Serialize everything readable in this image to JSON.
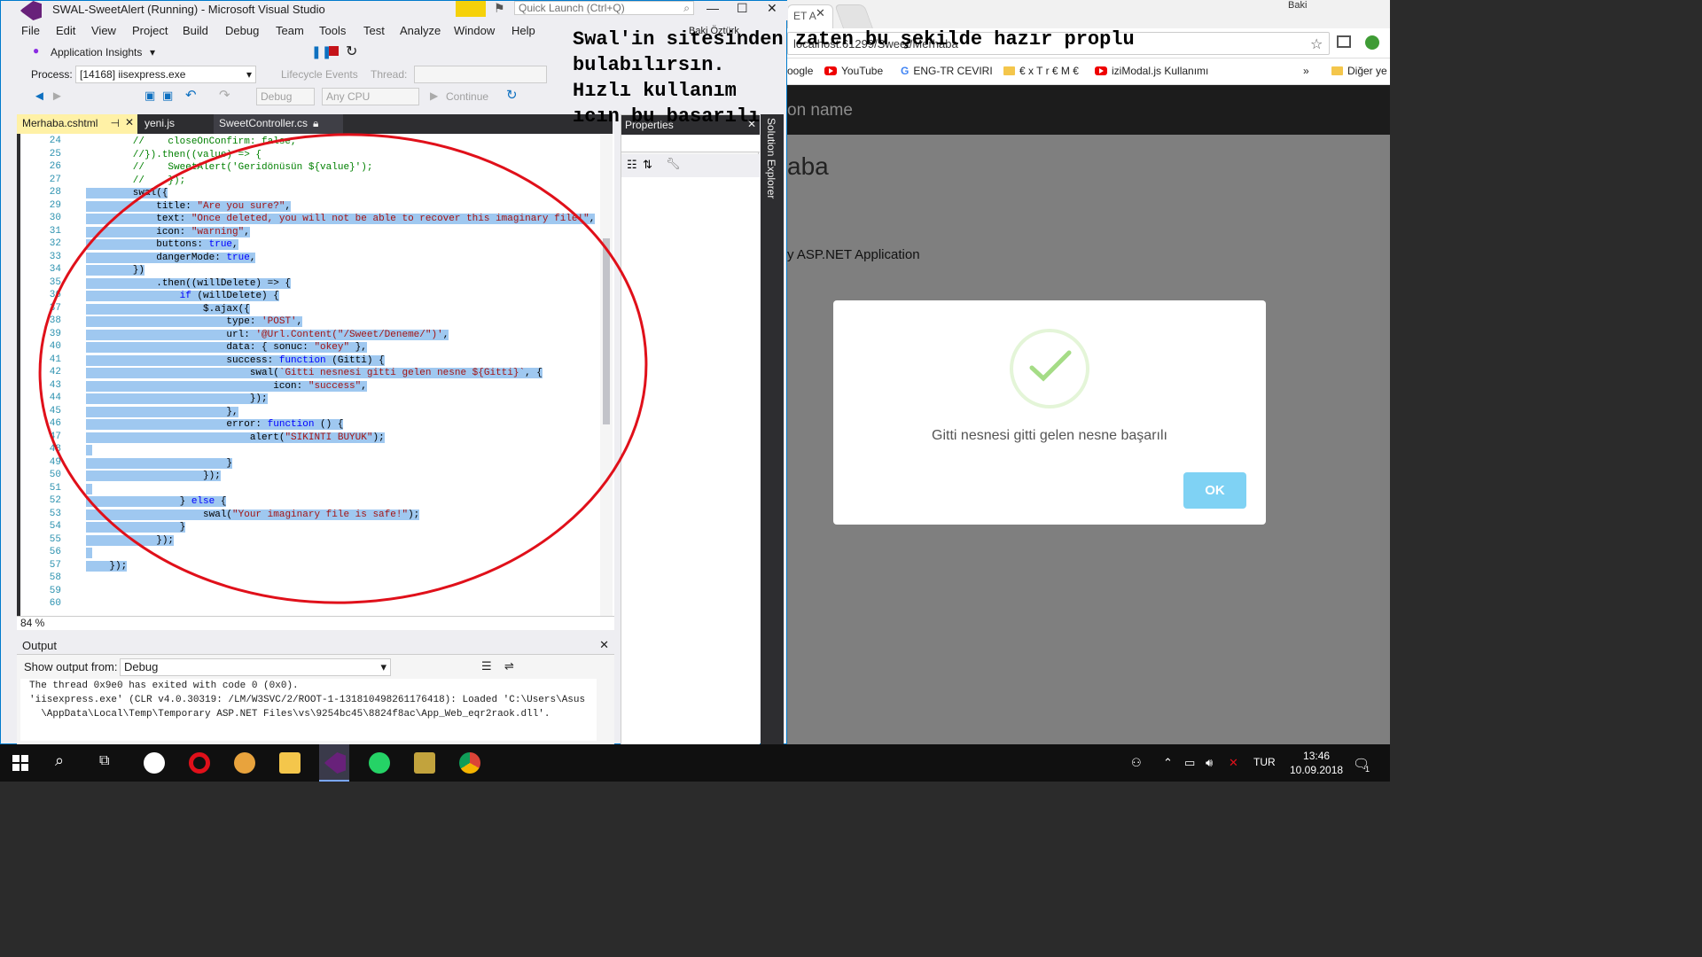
{
  "browser": {
    "tabs": [
      "ET A",
      ""
    ],
    "address_fragment": "localhost:61299/Sweet/Merhaba",
    "bookmarks": [
      "oogle",
      "YouTube",
      "ENG-TR CEVIRI",
      "€ x T r € M €",
      "iziModal.js Kullanımı"
    ],
    "bookmarks_more": "»",
    "other_bookmarks": "Diğer ye",
    "user_name": "Baki",
    "site_brand": "on name",
    "site_h1": "aba",
    "site_p": "y ASP.NET Application",
    "modal": {
      "text": "Gitti nesnesi gitti gelen nesne başarılı",
      "ok_label": "OK",
      "ok_color": "#7fd2f4",
      "check_color": "#a5dc86"
    }
  },
  "vs": {
    "title": "SWAL-SweetAlert (Running) - Microsoft Visual Studio",
    "quick_launch_placeholder": "Quick Launch (Ctrl+Q)",
    "user": "Baki Öztürk",
    "menu": [
      "File",
      "Edit",
      "View",
      "Project",
      "Build",
      "Debug",
      "Team",
      "Tools",
      "Test",
      "Analyze",
      "Window",
      "Help"
    ],
    "toolbar1": {
      "app_insights": "Application Insights"
    },
    "toolbar2": {
      "process_label": "Process:",
      "process_value": "[14168] iisexpress.exe",
      "lifecycle": "Lifecycle Events",
      "thread_label": "Thread:"
    },
    "toolbar3": {
      "config": "Debug",
      "platform": "Any CPU",
      "continue": "Continue"
    },
    "doc_tabs": [
      "Merhaba.cshtml",
      "yeni.js",
      "SweetController.cs"
    ],
    "zoom": "84 %",
    "properties_title": "Properties",
    "solution_explorer": "Solution Explorer",
    "output": {
      "title": "Output",
      "show_from_label": "Show output from:",
      "show_from_value": "Debug",
      "lines": [
        "The thread 0x9e0 has exited with code 0 (0x0).",
        "'iisexpress.exe' (CLR v4.0.30319: /LM/W3SVC/2/ROOT-1-131810498261176418): Loaded 'C:\\Users\\Asus",
        "  \\AppData\\Local\\Temp\\Temporary ASP.NET Files\\vs\\9254bc45\\8824f8ac\\App_Web_eqr2raok.dll'."
      ]
    },
    "code_lines": [
      {
        "n": "24",
        "t": "        //    closeOnConfirm: false,"
      },
      {
        "n": "25",
        "t": "        //}).then((value) => {"
      },
      {
        "n": "26",
        "t": "        //    SweetAlert('Geridönüsün ${value}');"
      },
      {
        "n": "27",
        "t": "        //    });"
      },
      {
        "n": "28",
        "t": "        swal({"
      },
      {
        "n": "29",
        "t": "            title: \"Are you sure?\","
      },
      {
        "n": "30",
        "t": "            text: \"Once deleted, you will not be able to recover this imaginary file!\","
      },
      {
        "n": "31",
        "t": "            icon: \"warning\","
      },
      {
        "n": "32",
        "t": "            buttons: true,"
      },
      {
        "n": "33",
        "t": "            dangerMode: true,"
      },
      {
        "n": "34",
        "t": "        })"
      },
      {
        "n": "35",
        "t": "            .then((willDelete) => {"
      },
      {
        "n": "36",
        "t": "                if (willDelete) {"
      },
      {
        "n": "37",
        "t": "                    $.ajax({"
      },
      {
        "n": "38",
        "t": "                        type: 'POST',"
      },
      {
        "n": "39",
        "t": "                        url: '@Url.Content(\"/Sweet/Deneme/\")',"
      },
      {
        "n": "40",
        "t": "                        data: { sonuc: \"okey\" },"
      },
      {
        "n": "41",
        "t": "                        success: function (Gitti) {"
      },
      {
        "n": "42",
        "t": "                            swal(`Gitti nesnesi gitti gelen nesne ${Gitti}`, {"
      },
      {
        "n": "43",
        "t": "                                icon: \"success\","
      },
      {
        "n": "44",
        "t": "                            });"
      },
      {
        "n": "45",
        "t": "                        },"
      },
      {
        "n": "46",
        "t": "                        error: function () {"
      },
      {
        "n": "47",
        "t": "                            alert(\"SIKINTI BUYUK\");"
      },
      {
        "n": "48",
        "t": " "
      },
      {
        "n": "49",
        "t": "                        }"
      },
      {
        "n": "50",
        "t": "                    });"
      },
      {
        "n": "51",
        "t": ""
      },
      {
        "n": "52",
        "t": "                } else {"
      },
      {
        "n": "53",
        "t": "                    swal(\"Your imaginary file is safe!\");"
      },
      {
        "n": "54",
        "t": "                }"
      },
      {
        "n": "55",
        "t": "            });"
      },
      {
        "n": "56",
        "t": " "
      },
      {
        "n": "57",
        "t": "    });"
      },
      {
        "n": "58",
        "t": ""
      },
      {
        "n": "59",
        "t": ""
      },
      {
        "n": "60",
        "t": ""
      }
    ]
  },
  "annotation": [
    "Swal'in sitesinden zaten bu şekilde hazır proplu",
    "bulabılırsın.",
    " Hızlı kullanım",
    "ıcın bu basarılı"
  ],
  "annotation_circle_color": "#e0101a",
  "taskbar": {
    "lang": "TUR",
    "time": "13:46",
    "date": "10.09.2018",
    "notif_count": "1"
  }
}
